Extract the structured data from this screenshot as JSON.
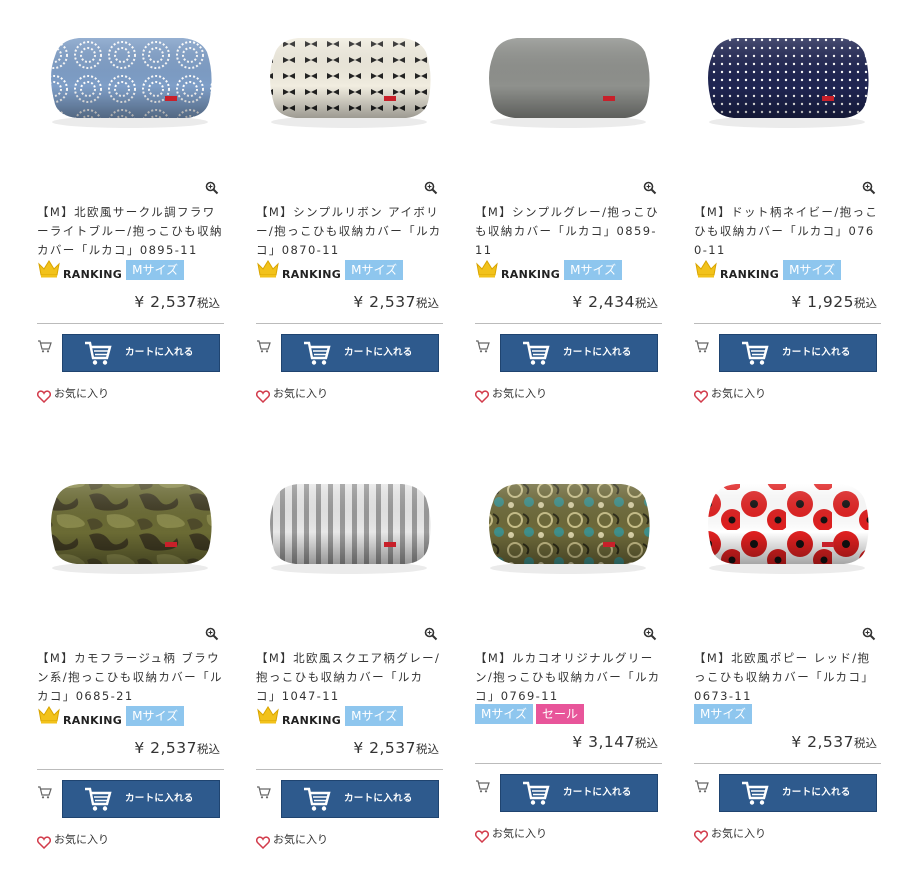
{
  "products": [
    {
      "title": "【M】北欧風サークル調フラワーライトブルー/抱っこひも収納カバー「ルカコ」0895-11",
      "price": "¥ 2,537",
      "tax": "税込",
      "ranking": "RANKING",
      "size": "Mサイズ",
      "sale": "",
      "fabric": {
        "base": "#7f9fc8",
        "pattern": "circles",
        "accent": "#ffffff"
      }
    },
    {
      "title": "【M】シンプルリボン アイボリー/抱っこひも収納カバー「ルカコ」0870-11",
      "price": "¥ 2,537",
      "tax": "税込",
      "ranking": "RANKING",
      "size": "Mサイズ",
      "sale": "",
      "fabric": {
        "base": "#f1ede0",
        "pattern": "bows",
        "accent": "#222222"
      }
    },
    {
      "title": "【M】シンプルグレー/抱っこひも収納カバー「ルカコ」0859-11",
      "price": "¥ 2,434",
      "tax": "税込",
      "ranking": "RANKING",
      "size": "Mサイズ",
      "sale": "",
      "fabric": {
        "base": "#8f918d",
        "pattern": "plain",
        "accent": "#ffffff"
      }
    },
    {
      "title": "【M】ドット柄ネイビー/抱っこひも収納カバー「ルカコ」0760-11",
      "price": "¥ 1,925",
      "tax": "税込",
      "ranking": "RANKING",
      "size": "Mサイズ",
      "sale": "",
      "fabric": {
        "base": "#1f2552",
        "pattern": "dots",
        "accent": "#ffffff"
      }
    },
    {
      "title": "【M】カモフラージュ柄 ブラウン系/抱っこひも収納カバー「ルカコ」0685-21",
      "price": "¥ 2,537",
      "tax": "税込",
      "ranking": "RANKING",
      "size": "Mサイズ",
      "sale": "",
      "fabric": {
        "base": "#6b6b34",
        "pattern": "camo",
        "accent": "#3f3a22"
      }
    },
    {
      "title": "【M】北欧風スクエア柄グレー/抱っこひも収納カバー「ルカコ」1047-11",
      "price": "¥ 2,537",
      "tax": "税込",
      "ranking": "RANKING",
      "size": "Mサイズ",
      "sale": "",
      "fabric": {
        "base": "#e8e8e8",
        "pattern": "stripes",
        "accent": "#9a9a9a"
      }
    },
    {
      "title": "【M】ルカコオリジナルグリーン/抱っこひも収納カバー「ルカコ」0769-11",
      "price": "¥ 3,147",
      "tax": "税込",
      "ranking": "",
      "size": "Mサイズ",
      "sale": "セール",
      "fabric": {
        "base": "#6e6a3a",
        "pattern": "paisley",
        "accent": "#c9c08a"
      }
    },
    {
      "title": "【M】北欧風ポピー レッド/抱っこひも収納カバー「ルカコ」0673-11",
      "price": "¥ 2,537",
      "tax": "税込",
      "ranking": "",
      "size": "Mサイズ",
      "sale": "",
      "fabric": {
        "base": "#e02020",
        "pattern": "poppy",
        "accent": "#111111"
      }
    }
  ],
  "cart_label": "カートに入れる",
  "favorite_label": "お気に入り",
  "colors": {
    "cart_button": "#2e5a8d",
    "size_tag": "#8ec6ee",
    "sale_tag": "#e8559a",
    "heart": "#d23b4b",
    "crown": "#f2c21b"
  }
}
